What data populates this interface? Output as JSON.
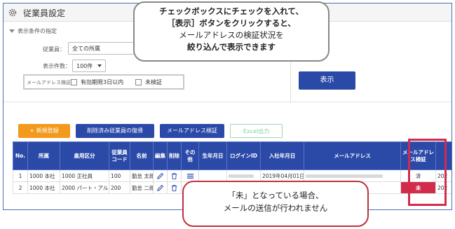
{
  "app": {
    "title": "従業員設定"
  },
  "filters": {
    "section_label": "表示条件の指定",
    "employee_label": "従業員：",
    "employee_value": "全ての所属",
    "count_label": "表示件数：",
    "count_value": "100件",
    "email_label": "メールアドレス検証：",
    "opt_expiry": "有効期限3日以内",
    "opt_unverified": "未検証"
  },
  "display_button": "表示",
  "toolbar": {
    "new_label": "+ 新規登録",
    "restore_label": "削除済み従業員の復帰",
    "verify_label": "メールアドレス検証",
    "excel_label": "Excel出力"
  },
  "table": {
    "headers": [
      "No.",
      "所属",
      "雇用区分",
      "従業員コード",
      "名前",
      "編集",
      "削除",
      "その他",
      "生年月日",
      "ログインID",
      "入社年月日",
      "メールアドレス",
      "メールアドレス検証",
      ""
    ],
    "rows": [
      {
        "no": "1",
        "dept": "1000 本社",
        "emp_type": "1000 正社員",
        "code": "100",
        "name": "勤怠 太郎",
        "join": "2019年04月01日",
        "verify": "済",
        "extra": "202"
      },
      {
        "no": "2",
        "dept": "1000 本社",
        "emp_type": "2000 パート・アルバイト",
        "code": "200",
        "name": "勤怠 二郎",
        "join": "",
        "verify": "未",
        "extra": "202"
      }
    ]
  },
  "callout_top": {
    "line1": "チェックボックスにチェックを入れて、",
    "line2": "［表示］ボタンをクリックすると、",
    "line3": "メールアドレスの検証状況を",
    "line4": "絞り込んで表示できます"
  },
  "callout_bottom": {
    "line1": "「未」となっている場合、",
    "line2": "メールの送信が行われません"
  },
  "colors": {
    "primary": "#2b4aa8",
    "orange": "#f39a1d",
    "alert_red": "#d22b4b",
    "excel_green": "#7fcf9d"
  },
  "icons": [
    "gear-icon",
    "pencil-icon",
    "trash-icon",
    "menu-icon",
    "caret-down-icon"
  ]
}
